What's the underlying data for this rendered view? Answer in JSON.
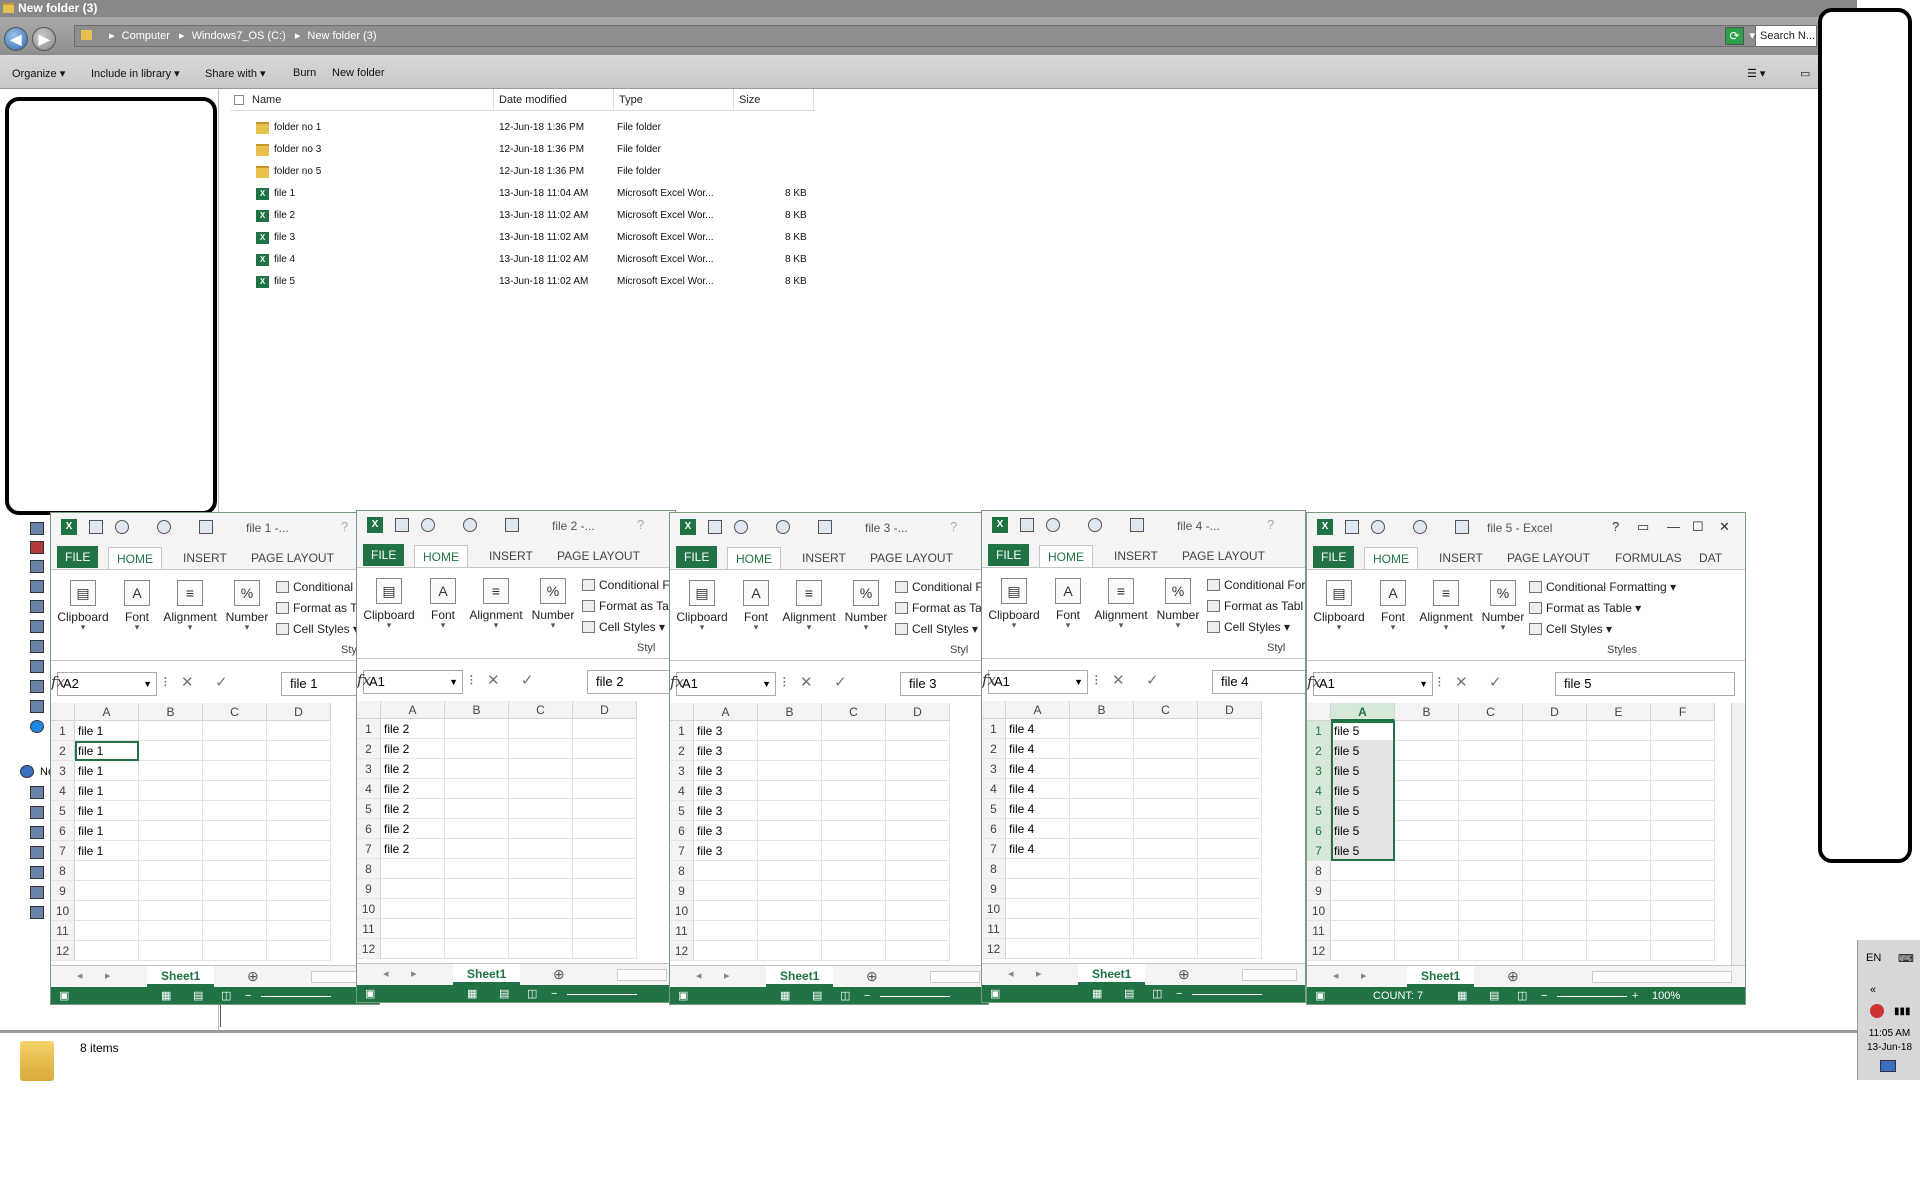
{
  "explorer": {
    "title": "New folder (3)",
    "breadcrumb": [
      "Computer",
      "Windows7_OS (C:)",
      "New folder (3)"
    ],
    "search_placeholder": "Search N...",
    "toolbar": {
      "organize": "Organize",
      "include_in_library": "Include in library",
      "share_with": "Share with",
      "burn": "Burn",
      "new_folder": "New folder"
    },
    "columns": [
      "Name",
      "Date modified",
      "Type",
      "Size"
    ],
    "files": [
      {
        "name": "folder no 1",
        "date": "12-Jun-18 1:36 PM",
        "type": "File folder",
        "size": "",
        "icon": "folder-icon"
      },
      {
        "name": "folder no 3",
        "date": "12-Jun-18 1:36 PM",
        "type": "File folder",
        "size": "",
        "icon": "folder-icon"
      },
      {
        "name": "folder no 5",
        "date": "12-Jun-18 1:36 PM",
        "type": "File folder",
        "size": "",
        "icon": "folder-icon"
      },
      {
        "name": "file 1",
        "date": "13-Jun-18 11:04 AM",
        "type": "Microsoft Excel Wor...",
        "size": "8 KB",
        "icon": "excel-file-icon"
      },
      {
        "name": "file 2",
        "date": "13-Jun-18 11:02 AM",
        "type": "Microsoft Excel Wor...",
        "size": "8 KB",
        "icon": "excel-file-icon"
      },
      {
        "name": "file 3",
        "date": "13-Jun-18 11:02 AM",
        "type": "Microsoft Excel Wor...",
        "size": "8 KB",
        "icon": "excel-file-icon"
      },
      {
        "name": "file 4",
        "date": "13-Jun-18 11:02 AM",
        "type": "Microsoft Excel Wor...",
        "size": "8 KB",
        "icon": "excel-file-icon"
      },
      {
        "name": "file 5",
        "date": "13-Jun-18 11:02 AM",
        "type": "Microsoft Excel Wor...",
        "size": "8 KB",
        "icon": "excel-file-icon"
      }
    ],
    "status_count": "8 items",
    "nav_label": "Ne"
  },
  "taskbar": {
    "lang": "EN",
    "time": "11:05 AM",
    "date": "13-Jun-18"
  },
  "excel_common": {
    "tabs": {
      "file": "FILE",
      "home": "HOME",
      "insert": "INSERT",
      "page_layout": "PAGE LAYOUT",
      "formulas": "FORMULAS",
      "data": "DAT"
    },
    "groups": {
      "clipboard": "Clipboard",
      "font": "Font",
      "alignment": "Alignment",
      "number": "Number",
      "styles": "Styles"
    },
    "styles": {
      "cond_full": "Conditional Formatting",
      "cond_short1": "Conditional",
      "cond_short2": "Conditional F",
      "cond_short4": "Conditional For",
      "fmt_full": "Format as Table",
      "fmt_short1": "Format as T",
      "fmt_short2": "Format as Ta",
      "fmt_short4": "Format as Tabl",
      "cell": "Cell Styles"
    },
    "styles_short": "Styl",
    "sheet_tab": "Sheet1",
    "columns": [
      "A",
      "B",
      "C",
      "D",
      "E",
      "F"
    ],
    "rows": [
      "1",
      "2",
      "3",
      "4",
      "5",
      "6",
      "7",
      "8",
      "9",
      "10",
      "11",
      "12"
    ],
    "fx": "fx",
    "zoom": "100%"
  },
  "excel_windows": [
    {
      "title": "file 1 -...",
      "namebox": "A2",
      "formula": "file 1",
      "cells": [
        "file 1",
        "file 1",
        "file 1",
        "file 1",
        "file 1",
        "file 1",
        "file 1"
      ]
    },
    {
      "title": "file 2 -...",
      "namebox": "A1",
      "formula": "file 2",
      "cells": [
        "file 2",
        "file 2",
        "file 2",
        "file 2",
        "file 2",
        "file 2",
        "file 2"
      ]
    },
    {
      "title": "file 3 -...",
      "namebox": "A1",
      "formula": "file 3",
      "cells": [
        "file 3",
        "file 3",
        "file 3",
        "file 3",
        "file 3",
        "file 3",
        "file 3"
      ]
    },
    {
      "title": "file 4 -...",
      "namebox": "A1",
      "formula": "file 4",
      "cells": [
        "file 4",
        "file 4",
        "file 4",
        "file 4",
        "file 4",
        "file 4",
        "file 4"
      ]
    },
    {
      "title": "file 5 - Excel",
      "namebox": "A1",
      "formula": "file 5",
      "cells": [
        "file 5",
        "file 5",
        "file 5",
        "file 5",
        "file 5",
        "file 5",
        "file 5"
      ],
      "status": "COUNT: 7"
    }
  ]
}
